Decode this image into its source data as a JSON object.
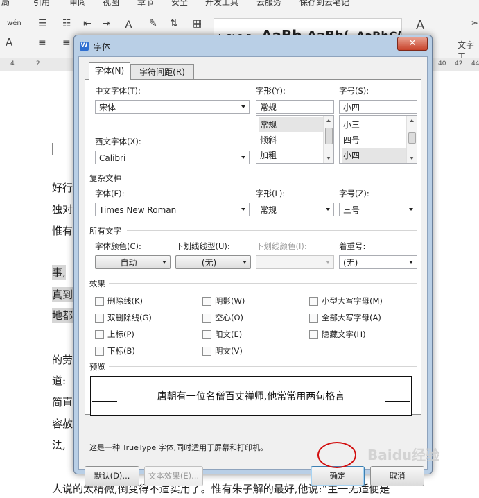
{
  "menubar": {
    "items": [
      "局",
      "引用",
      "审阅",
      "视图",
      "章节",
      "安全",
      "开发工具",
      "云服务",
      "保存到云笔记"
    ]
  },
  "ribbon": {
    "styles": [
      "AaBbCcDd",
      "AaBb",
      "AaBb(",
      "AaBbC("
    ],
    "text_tool_label": "文字工",
    "pinyin_label": "wén",
    "ruler_numbers": [
      "4",
      "2",
      "40",
      "42",
      "44"
    ]
  },
  "document": {
    "lines": [
      {
        "text": "好行"
      },
      {
        "text": "独对"
      },
      {
        "text": "惟有"
      },
      {
        "text": "事,"
      },
      {
        "text": "真到"
      },
      {
        "text": "地都"
      },
      {
        "text": "的劳"
      },
      {
        "text": "道:"
      },
      {
        "text": "简直"
      },
      {
        "text": "容赦"
      },
      {
        "text": "法,"
      }
    ],
    "bottom_line": "人说的太精微,倒变得不适实用了。惟有朱子解的最好,他说:“主一无适便是"
  },
  "dialog": {
    "title": "字体",
    "icon_letter": "W",
    "tabs": [
      "字体(N)",
      "字符间距(R)"
    ],
    "chinese_font": {
      "label": "中文字体(T):",
      "value": "宋体"
    },
    "western_font": {
      "label": "西文字体(X):",
      "value": "Calibri"
    },
    "style": {
      "label": "字形(Y):",
      "value": "常规",
      "options": [
        "常规",
        "倾斜",
        "加粗"
      ],
      "selected": "常规"
    },
    "size": {
      "label": "字号(S):",
      "value": "小四",
      "options": [
        "小三",
        "四号",
        "小四"
      ],
      "selected": "小四"
    },
    "complex": {
      "section": "复杂文种",
      "font_label": "字体(F):",
      "font_value": "Times New Roman",
      "style_label": "字形(L):",
      "style_value": "常规",
      "size_label": "字号(Z):",
      "size_value": "三号"
    },
    "all_text": {
      "section": "所有文字",
      "color_label": "字体颜色(C):",
      "color_value": "自动",
      "underline_label": "下划线线型(U):",
      "underline_value": "(无)",
      "underline_color_label": "下划线颜色(I):",
      "underline_color_value": "",
      "emphasis_label": "着重号:",
      "emphasis_value": "(无)"
    },
    "effects": {
      "section": "效果",
      "col1": [
        "删除线(K)",
        "双删除线(G)",
        "上标(P)",
        "下标(B)"
      ],
      "col2": [
        "阴影(W)",
        "空心(O)",
        "阳文(E)",
        "阴文(V)"
      ],
      "col3": [
        "小型大写字母(M)",
        "全部大写字母(A)",
        "隐藏文字(H)"
      ]
    },
    "preview": {
      "section": "预览",
      "text": "唐朝有一位名僧百丈禅师,他常常用两句格言"
    },
    "note": "这是一种 TrueType 字体,同时适用于屏幕和打印机。",
    "buttons": {
      "default": "默认(D)...",
      "text_effects": "文本效果(E)...",
      "ok": "确定",
      "cancel": "取消"
    }
  },
  "watermark": "Baidu经验",
  "colors": {
    "dialog_frame": "#b9cfe6",
    "close_button": "#c8432b",
    "annotation_ring": "#d20e0e"
  }
}
